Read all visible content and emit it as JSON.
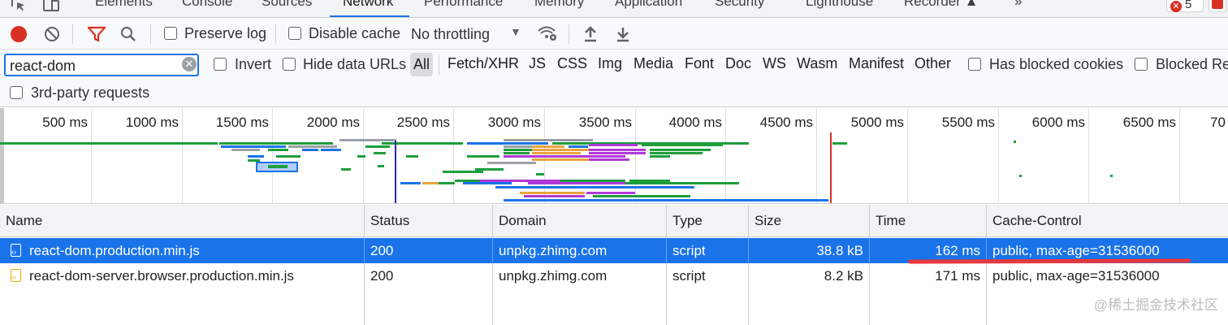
{
  "tabs": [
    "Elements",
    "Console",
    "Sources",
    "Network",
    "Performance",
    "Memory",
    "Application",
    "Security",
    "Lighthouse",
    "Recorder ▲",
    "»"
  ],
  "error_count": "5",
  "toolbar": {
    "preserve_log": "Preserve log",
    "disable_cache": "Disable cache",
    "throttling": "No throttling"
  },
  "filter": {
    "search_value": "react-dom",
    "invert": "Invert",
    "hide_data_urls": "Hide data URLs",
    "all": "All",
    "types": [
      "Fetch/XHR",
      "JS",
      "CSS",
      "Img",
      "Media",
      "Font",
      "Doc",
      "WS",
      "Wasm",
      "Manifest",
      "Other"
    ],
    "has_blocked_cookies": "Has blocked cookies",
    "blocked_requests": "Blocked Re",
    "third_party": "3rd-party requests"
  },
  "overview": {
    "ticks": [
      "500 ms",
      "1000 ms",
      "1500 ms",
      "2000 ms",
      "2500 ms",
      "3000 ms",
      "3500 ms",
      "4000 ms",
      "4500 ms",
      "5000 ms",
      "5500 ms",
      "6000 ms",
      "6500 ms",
      "70"
    ],
    "colors": {
      "green": "#1e9e3c",
      "blue": "#1a73e8",
      "orange": "#e8a33d",
      "purple": "#b03ad6",
      "gray": "#9aa0a6",
      "dom_line": "#2a2aa8",
      "load_line": "#d93025"
    }
  },
  "table": {
    "columns": [
      "Name",
      "Status",
      "Domain",
      "Type",
      "Size",
      "Time",
      "Cache-Control"
    ],
    "rows": [
      {
        "name": "react-dom.production.min.js",
        "status": "200",
        "domain": "unpkg.zhimg.com",
        "type": "script",
        "size": "38.8 kB",
        "time": "162 ms",
        "cache": "public, max-age=31536000"
      },
      {
        "name": "react-dom-server.browser.production.min.js",
        "status": "200",
        "domain": "unpkg.zhimg.com",
        "type": "script",
        "size": "8.2 kB",
        "time": "171 ms",
        "cache": "public, max-age=31536000"
      }
    ]
  },
  "watermark": "@稀土掘金技术社区"
}
